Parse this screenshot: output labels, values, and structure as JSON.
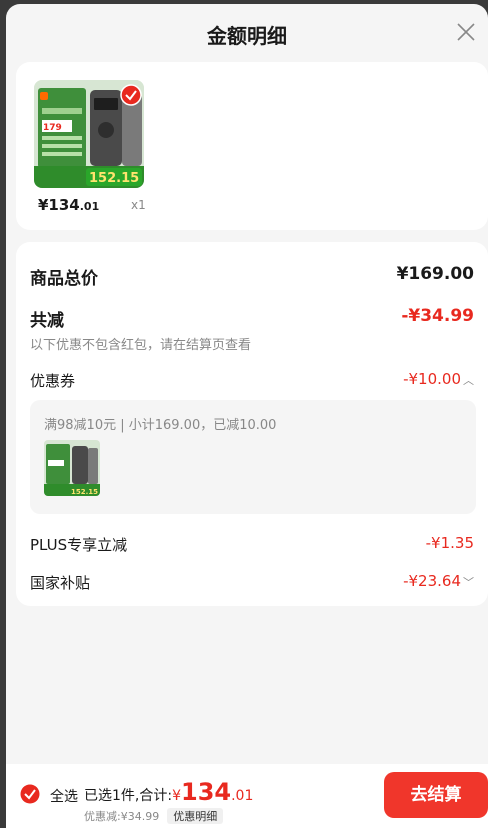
{
  "header": {
    "title": "金额明细"
  },
  "product": {
    "price_int": "¥134",
    "price_dec": ".01",
    "qty": "x1"
  },
  "detail": {
    "total_label": "商品总价",
    "total_value": "¥169.00",
    "discount_label": "共减",
    "discount_value": "-¥34.99",
    "discount_note": "以下优惠不包含红包，请在结算页查看",
    "coupon_label": "优惠券",
    "coupon_value": "-¥10.00",
    "coupon_desc": "满98减10元 | 小计169.00，已减10.00",
    "plus_label": "PLUS专享立减",
    "plus_value": "-¥1.35",
    "subsidy_label": "国家补贴",
    "subsidy_value": "-¥23.64"
  },
  "bottom": {
    "select_all": "全选",
    "selected_text": "已选1件,合计:",
    "total_yen": "¥",
    "total_int": "134",
    "total_dec": ".01",
    "savings": "优惠减:¥34.99",
    "detail_link": "优惠明细",
    "checkout": "去结算"
  },
  "colors": {
    "accent": "#e8291f",
    "button": "#f0362b"
  }
}
